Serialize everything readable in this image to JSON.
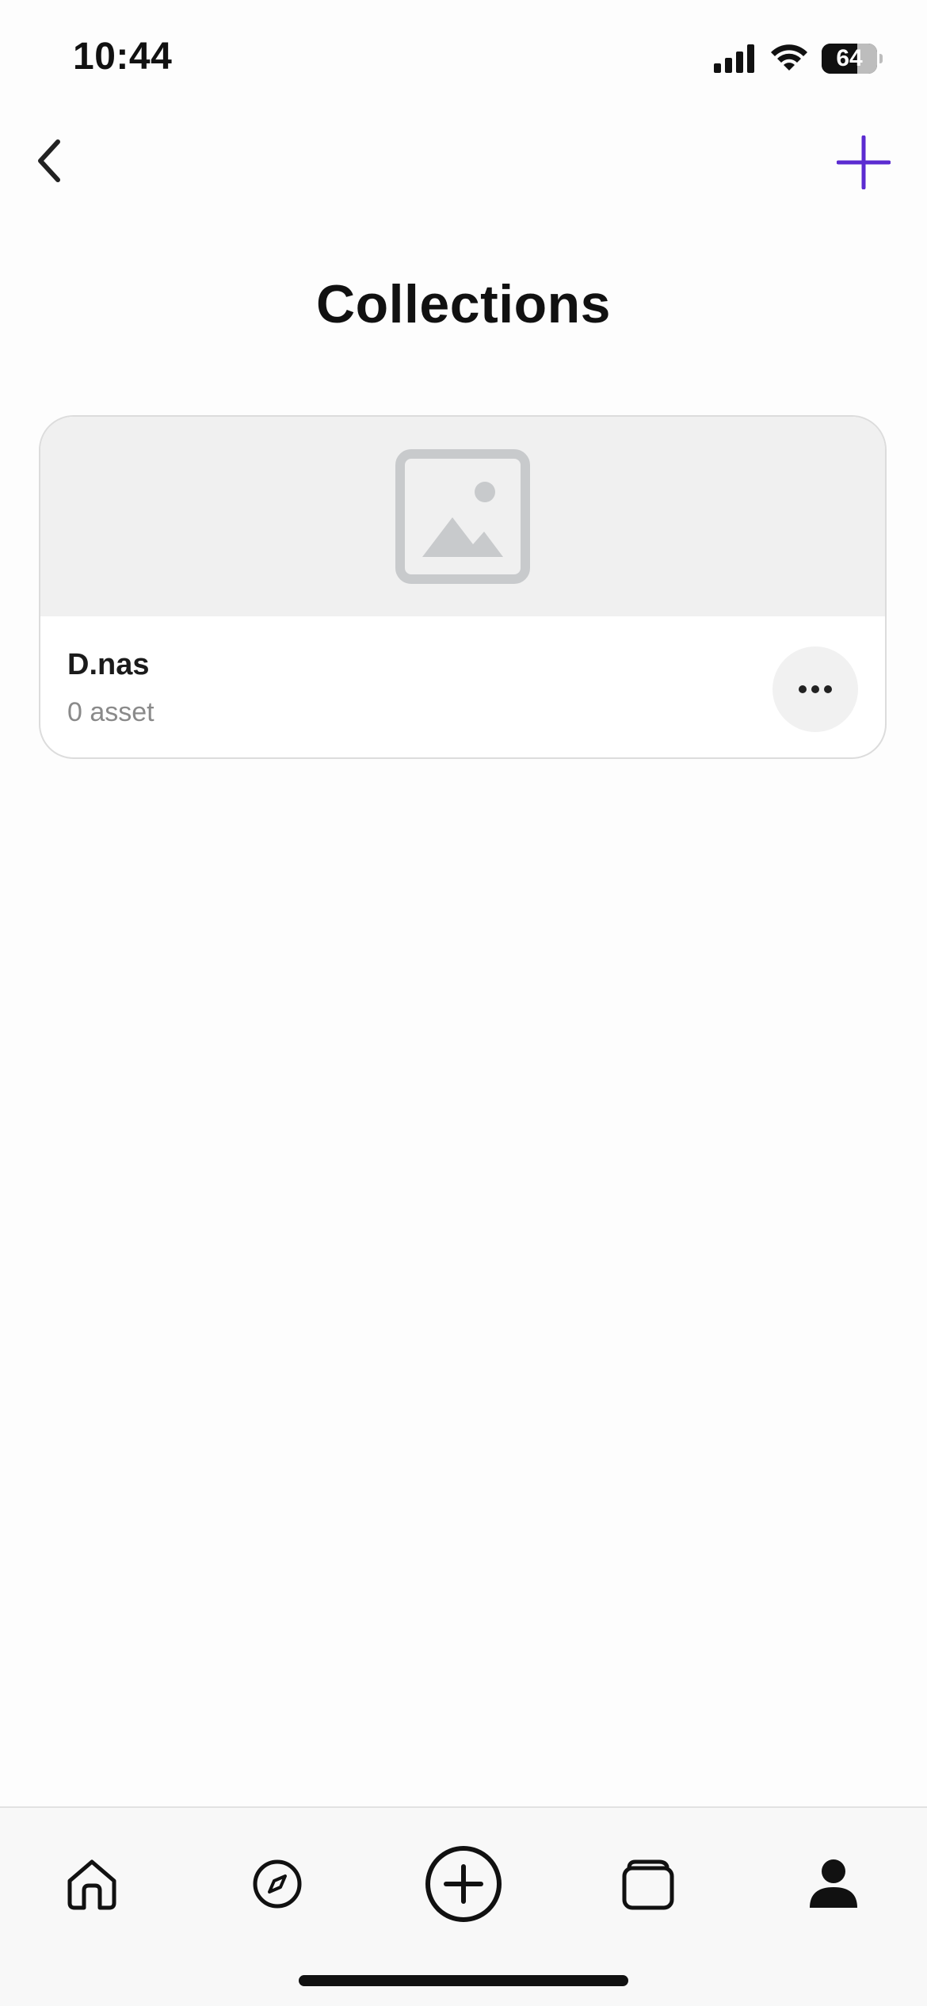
{
  "status": {
    "time": "10:44",
    "battery": "64",
    "battery_level": 0.64
  },
  "header": {
    "title": "Collections"
  },
  "collections": [
    {
      "name": "D.nas",
      "count": "0 asset"
    }
  ],
  "icons": {
    "back": "chevron-left-icon",
    "add": "plus-icon",
    "placeholder": "image-placeholder-icon",
    "more": "ellipsis-icon",
    "tabs": [
      "home-icon",
      "compass-icon",
      "plus-circle-icon",
      "collections-icon",
      "profile-icon"
    ]
  },
  "colors": {
    "accent": "#5b2bd1",
    "text": "#111111",
    "muted": "#8a8a8a",
    "placeholder": "#c8cacc"
  }
}
